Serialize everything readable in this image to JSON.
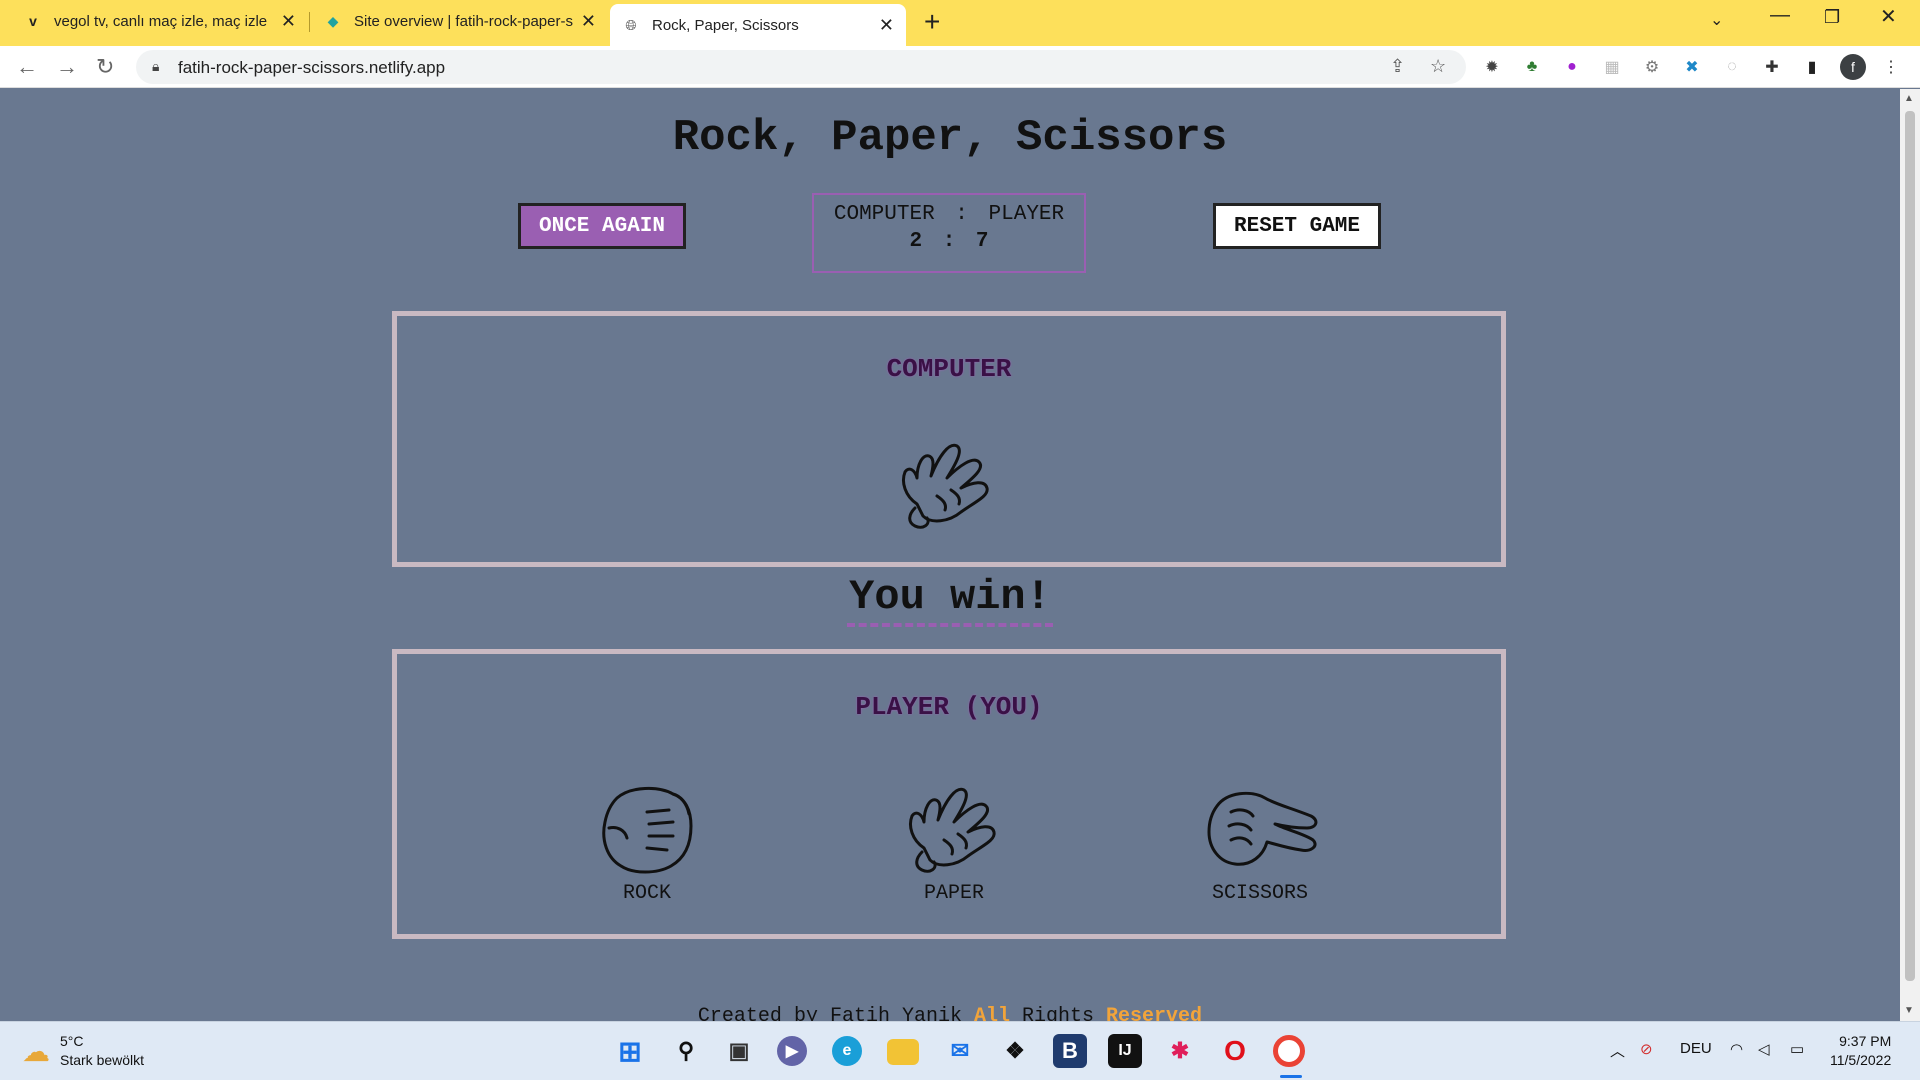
{
  "browser": {
    "tabs": [
      {
        "title": "vegol tv, canlı maç izle, maç izle",
        "favicon": "vegol-icon"
      },
      {
        "title": "Site overview | fatih-rock-paper-s",
        "favicon": "netlify-icon"
      },
      {
        "title": "Rock, Paper, Scissors",
        "favicon": "globe-icon"
      }
    ],
    "url": "fatih-rock-paper-scissors.netlify.app",
    "profile_initial": "f"
  },
  "game": {
    "title": "Rock, Paper, Scissors",
    "once_again_label": "ONCE AGAIN",
    "reset_label": "RESET GAME",
    "score": {
      "computer_label": "COMPUTER",
      "separator": ":",
      "player_label": "PLAYER",
      "computer": "2",
      "player": "7"
    },
    "computer_panel_title": "COMPUTER",
    "computer_choice": "paper",
    "result": "You win!",
    "player_panel_title": "PLAYER (YOU)",
    "choices": [
      {
        "id": "rock",
        "label": "ROCK"
      },
      {
        "id": "paper",
        "label": "PAPER"
      },
      {
        "id": "scissors",
        "label": "SCISSORS"
      }
    ],
    "footer": {
      "part1": "Created by Fatih Yanik",
      "part2": "All",
      "part3": "Rights",
      "part4": "Reserved"
    }
  },
  "colors": {
    "page_bg": "#697890",
    "accent_purple": "#9a5fb2",
    "chrome_yellow": "#fde05b",
    "footer_highlight": "#f2a43a"
  },
  "taskbar": {
    "weather_temp": "5°C",
    "weather_desc": "Stark bewölkt",
    "language": "DEU",
    "time": "9:37 PM",
    "date": "11/5/2022"
  }
}
